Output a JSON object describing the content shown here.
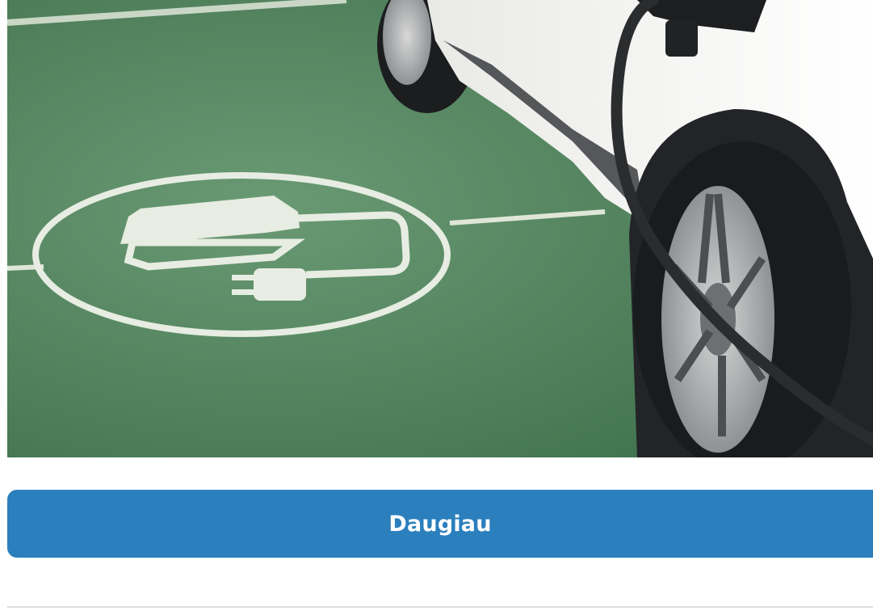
{
  "hero_image": {
    "alt": "",
    "subject": "electric-car-charging-parking-spot"
  },
  "more_button": {
    "label": "Daugiau",
    "color": "#2b7fbd",
    "text_color": "#ffffff"
  },
  "colors": {
    "ground": "#4f7f5c",
    "car_body": "#f3f3f1",
    "cable": "#2a2c2e",
    "divider": "#dedede"
  }
}
